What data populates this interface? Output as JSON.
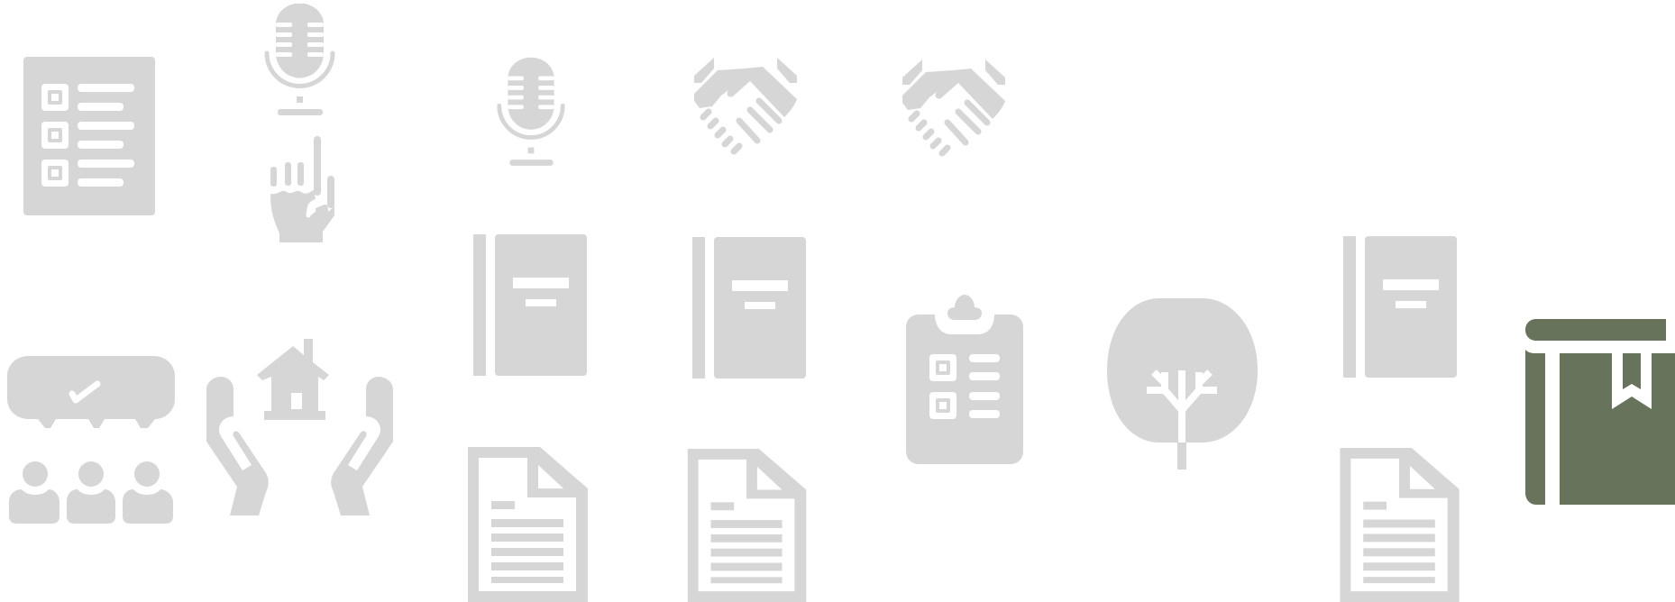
{
  "colors": {
    "icon_gray": "#d6d6d6",
    "accent_green": "#68735b",
    "background": "#ffffff"
  },
  "icons": [
    "checklist-icon",
    "microphone-icon",
    "raised-hand-icon",
    "microphone-icon",
    "handshake-icon",
    "handshake-icon",
    "speech-bubble-group-icon",
    "hands-holding-house-icon",
    "notebook-icon",
    "notebook-icon",
    "clipboard-checklist-icon",
    "tree-icon",
    "notebook-icon",
    "bookmarked-book-icon",
    "document-icon",
    "document-icon",
    "document-icon"
  ]
}
